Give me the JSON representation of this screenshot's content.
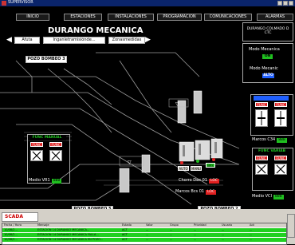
{
  "window": {
    "title": "SUPERVISOR"
  },
  "menu": [
    "INICIO",
    "ESTACIONES",
    "INSTALACIONES",
    "PROGRAMACION",
    "COMUNICACIONES",
    "ALARMAS"
  ],
  "main": {
    "title": "DURANGO MECANICA",
    "left_box": "Afuta",
    "mid_box": "Inganletramisiónde...",
    "right_box": "Zonasmedidas"
  },
  "stations": {
    "pozo3": "POZO BOMBEO 3",
    "pozo5": "POZO BOMBEO 5",
    "pozo2": "POZO BOMBEO 2"
  },
  "right_panel": {
    "header_line1": "DURANGO COLMADO D",
    "header_line2": "CTC",
    "mode_label": "Modo Mecanica",
    "mode_value": "ON",
    "sub_label": "Modo Mecanic",
    "sub_value": "ALTO"
  },
  "ctrl_left": {
    "title": "FUNC MANUAL",
    "btn1": "FUNC",
    "btn2": "FUNC",
    "val_label": "Medio VR1",
    "val": "888"
  },
  "ctrl_right_top": {
    "btn1": "FUNC",
    "btn2": "FUNC",
    "val_label": "Marcos C34",
    "val": "888"
  },
  "ctrl_right_bottom": {
    "title": "FUNC VARIAB",
    "btn1": "FUNC",
    "btn2": "FUNC",
    "val_label": "Medio VCI",
    "val": "888"
  },
  "mid_values": {
    "auto": "AUTO",
    "manu": "MANU",
    "bits": "Bits",
    "row1_label": "Chorro Dex 01",
    "row1_val": "LOC",
    "row2_label": "Marcos Bcs 01",
    "row2_val": "LOC"
  },
  "logo": "SCADA",
  "alarm_table": {
    "headers": [
      "Fecha / Hora",
      "Mensaje",
      "Estado",
      "Valor",
      "Grupo",
      "Prioridad",
      "Usuario",
      "Ack"
    ],
    "rows": [
      [
        "10/08/2...",
        "ESTACION 14 DURANGO MECANICA...",
        "ACT",
        "...",
        "...",
        "...",
        "...",
        "..."
      ],
      [
        "10/08/2...",
        "ESTACION 14 DURANGO MECANICA FALLA...",
        "ACT",
        "...",
        "...",
        "...",
        "...",
        "..."
      ],
      [
        "10/08/2...",
        "ESTACION 14 DURANGO MECANICA EN POZO...",
        "ACT",
        "...",
        "...",
        "...",
        "...",
        "..."
      ]
    ]
  },
  "colors": {
    "accent": "#0a246a",
    "ok": "#20c020",
    "alarm": "#e02020",
    "blue_ind": "#2060ff"
  }
}
